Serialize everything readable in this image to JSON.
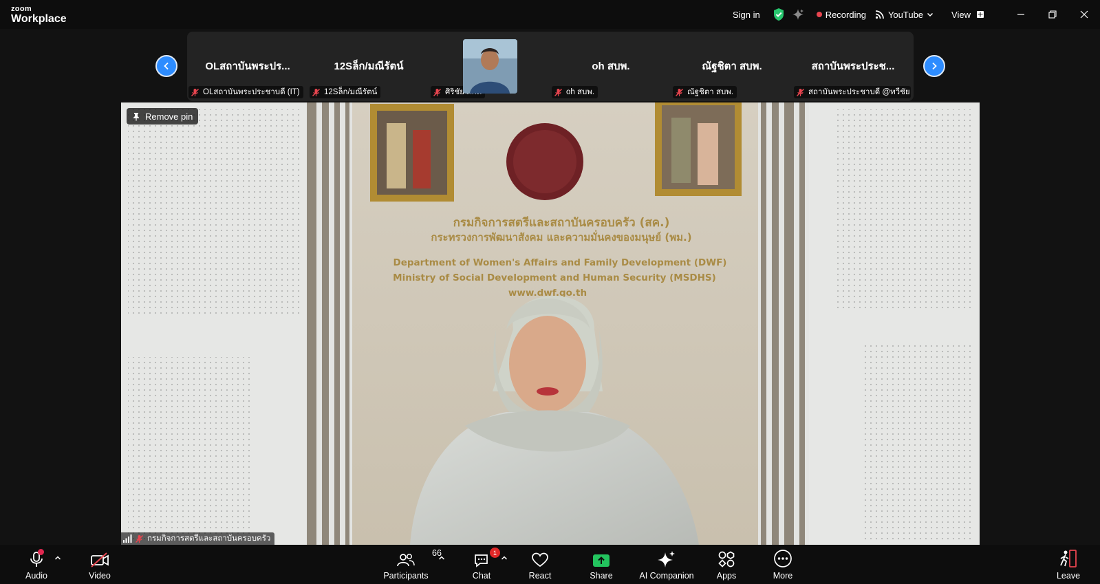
{
  "app": {
    "logo_top": "zoom",
    "logo_bottom": "Workplace"
  },
  "topbar": {
    "sign_in": "Sign in",
    "recording_label": "Recording",
    "livestream_label": "YouTube",
    "view_label": "View",
    "icons": [
      "shield-check-icon",
      "sparkle-icon",
      "record-dot-icon",
      "broadcast-icon",
      "chevron-down-icon",
      "view-grid-icon",
      "minimize-icon",
      "restore-icon",
      "close-icon"
    ]
  },
  "strip": {
    "tiles": [
      {
        "name": "OLสถาบันพระปร...",
        "label": "OLสถาบันพระประชาบดี (IT)"
      },
      {
        "name": "12Sล็ก/มณีรัตน์",
        "label": "12Sล็ก/มณีรัตน์"
      },
      {
        "name": "",
        "label": "ศิริชัย ภักดี"
      },
      {
        "name": "oh สบพ.",
        "label": "oh สบพ."
      },
      {
        "name": "ณัฐชิตา สบพ.",
        "label": "ณัฐชิตา สบพ."
      },
      {
        "name": "สถาบันพระประช...",
        "label": "สถาบันพระประชาบดี @ทวีชัย"
      }
    ]
  },
  "main_video": {
    "pin_label": "Remove pin",
    "speaker_label": "กรมกิจการสตรีและสถาบันครอบครัว",
    "wall_sign": {
      "thai_line1": "กรมกิจการสตรีและสถาบันครอบครัว (สค.)",
      "thai_line2": "กระทรวงการพัฒนาสังคม และความมั่นคงของมนุษย์ (พม.)",
      "en_line1": "Department of Women's Affairs and Family Development (DWF)",
      "en_line2": "Ministry of Social Development and Human Security (MSDHS)",
      "url": "www.dwf.go.th"
    }
  },
  "toolbar": {
    "audio": "Audio",
    "video": "Video",
    "participants": "Participants",
    "participants_count": "66",
    "chat": "Chat",
    "chat_badge": "1",
    "react": "React",
    "share": "Share",
    "ai_companion": "AI Companion",
    "apps": "Apps",
    "more": "More",
    "leave": "Leave"
  },
  "colors": {
    "accent_blue": "#2d8cff",
    "share_green": "#23c45e",
    "mute_red": "#e8454f",
    "shield_green": "#28c76f"
  }
}
